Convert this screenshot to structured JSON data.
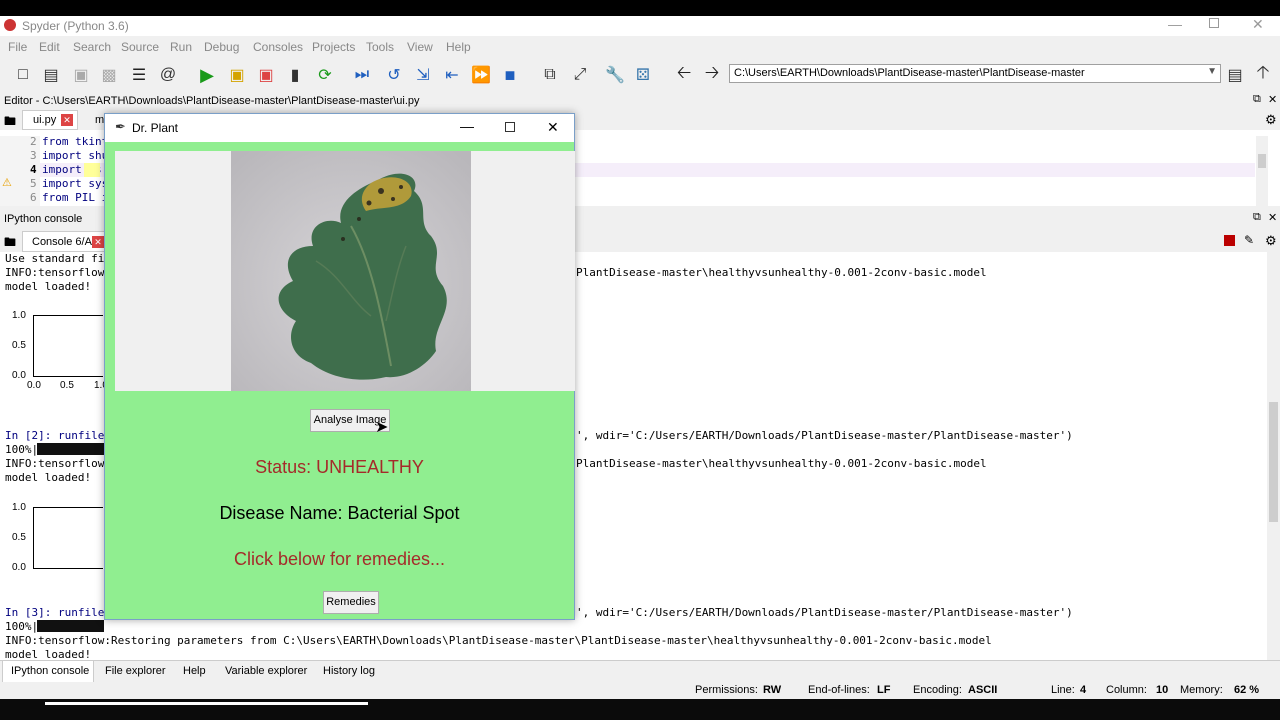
{
  "app": {
    "title": "Spyder (Python 3.6)",
    "window_controls": [
      "minimize",
      "restore",
      "close"
    ]
  },
  "menubar": [
    "File",
    "Edit",
    "Search",
    "Source",
    "Run",
    "Debug",
    "Consoles",
    "Projects",
    "Tools",
    "View",
    "Help"
  ],
  "toolbar": {
    "path": "C:\\Users\\EARTH\\Downloads\\PlantDisease-master\\PlantDisease-master"
  },
  "editor": {
    "header": "Editor - C:\\Users\\EARTH\\Downloads\\PlantDisease-master\\PlantDisease-master\\ui.py",
    "tabs": [
      "ui.py",
      "m"
    ],
    "lines": [
      {
        "num": "2",
        "code": "from tkint"
      },
      {
        "num": "3",
        "code": "import shu"
      },
      {
        "num": "4",
        "code": "import os"
      },
      {
        "num": "5",
        "code": "import sys"
      },
      {
        "num": "6",
        "code": "from PIL i"
      }
    ]
  },
  "console": {
    "header": "IPython console",
    "tab": "Console 6/A",
    "left_lines": {
      "l1": "Use standard fi",
      "l2": "INFO:tensorflow",
      "l3": "model loaded!",
      "l4": "In [2]: runfile",
      "l5": "100%|",
      "l6": "INFO:tensorflow",
      "l7": "model loaded!",
      "l8": "In [3]: runfile",
      "l9": "100%|",
      "l10": "INFO:tensorflow:Restoring parameters from C:\\Users\\EARTH\\Downloads\\PlantDisease-master\\PlantDisease-master\\healthyvsunhealthy-0.001-2conv-basic.model",
      "l11": "model loaded!"
    },
    "right_lines": {
      "r1": "PlantDisease-master\\healthyvsunhealthy-0.001-2conv-basic.model",
      "r2": "', wdir='C:/Users/EARTH/Downloads/PlantDisease-master/PlantDisease-master')",
      "r3": "PlantDisease-master\\healthyvsunhealthy-0.001-2conv-basic.model",
      "r4": "', wdir='C:/Users/EARTH/Downloads/PlantDisease-master/PlantDisease-master')"
    },
    "plot_ticks": {
      "y": [
        "1.0",
        "0.5",
        "0.0"
      ],
      "x": [
        "0.0",
        "0.5",
        "1.0"
      ]
    }
  },
  "bottom_tabs": [
    "IPython console",
    "File explorer",
    "Help",
    "Variable explorer",
    "History log"
  ],
  "statusbar": {
    "permissions_label": "Permissions:",
    "permissions": "RW",
    "eol_label": "End-of-lines:",
    "eol": "LF",
    "encoding_label": "Encoding:",
    "encoding": "ASCII",
    "line_label": "Line:",
    "line": "4",
    "column_label": "Column:",
    "column": "10",
    "memory_label": "Memory:",
    "memory": "62 %"
  },
  "drplant": {
    "title": "Dr. Plant",
    "analyse_button": "Analyse Image",
    "status": "Status: UNHEALTHY",
    "disease": "Disease Name: Bacterial Spot",
    "prompt": "Click below for remedies...",
    "remedies_button": "Remedies",
    "colors": {
      "background": "#90ee90",
      "status": "#a52a2a"
    }
  }
}
